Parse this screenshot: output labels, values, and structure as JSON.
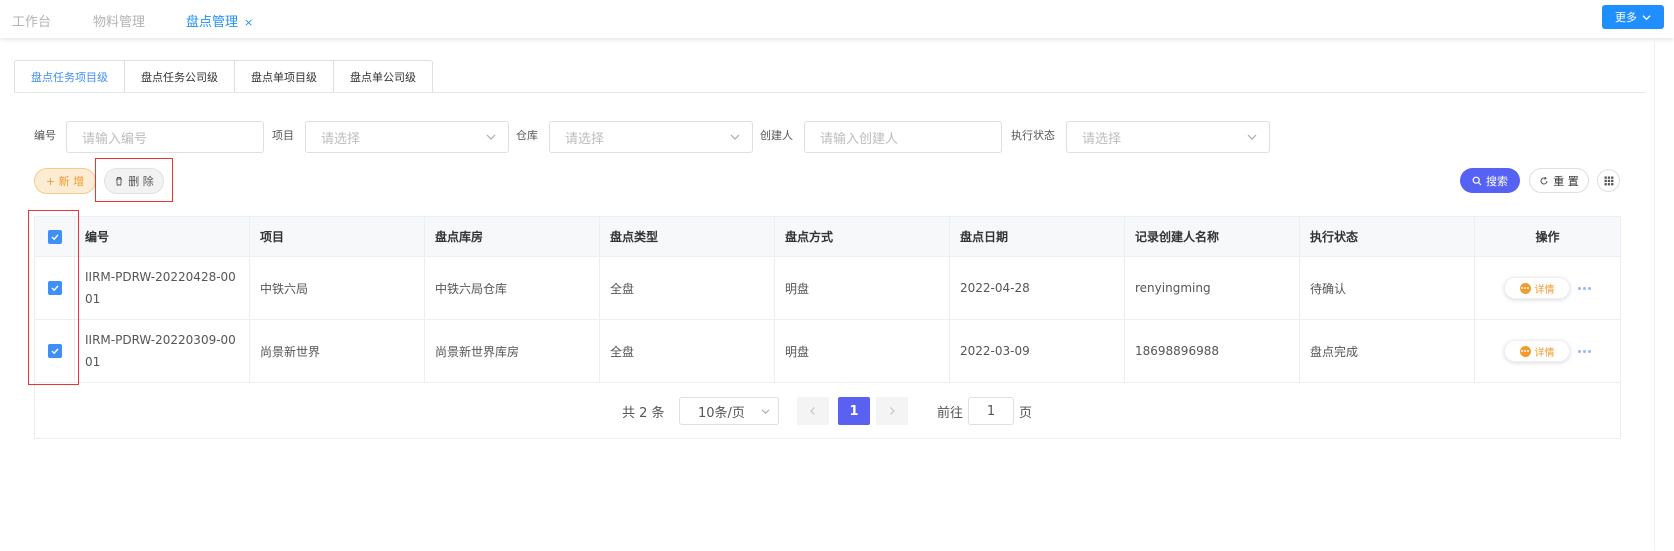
{
  "top_tabs": [
    {
      "label": "工作台"
    },
    {
      "label": "物料管理"
    },
    {
      "label": "盘点管理",
      "close": "×"
    }
  ],
  "more_button": "更多",
  "sub_tabs": [
    "盘点任务项目级",
    "盘点任务公司级",
    "盘点单项目级",
    "盘点单公司级"
  ],
  "filters": {
    "code": {
      "label": "编号",
      "placeholder": "请输入编号"
    },
    "project": {
      "label": "项目",
      "placeholder": "请选择"
    },
    "warehouse": {
      "label": "仓库",
      "placeholder": "请选择"
    },
    "creator": {
      "label": "创建人",
      "placeholder": "请输入创建人"
    },
    "status": {
      "label": "执行状态",
      "placeholder": "请选择"
    }
  },
  "actions": {
    "add": "+ 新 增",
    "delete": "删 除",
    "search": "搜索",
    "reset": "重 置"
  },
  "table": {
    "headers": [
      "编号",
      "项目",
      "盘点库房",
      "盘点类型",
      "盘点方式",
      "盘点日期",
      "记录创建人名称",
      "执行状态",
      "操作"
    ],
    "rows": [
      {
        "code": "IIRM-PDRW-20220428-0001",
        "project": "中铁六局",
        "warehouse": "中铁六局仓库",
        "type": "全盘",
        "method": "明盘",
        "date": "2022-04-28",
        "creator": "renyingming",
        "status": "待确认",
        "checked": true
      },
      {
        "code": "IIRM-PDRW-20220309-0001",
        "project": "尚景新世界",
        "warehouse": "尚景新世界库房",
        "type": "全盘",
        "method": "明盘",
        "date": "2022-03-09",
        "creator": "18698896988",
        "status": "盘点完成",
        "checked": true
      }
    ],
    "detail_label": "详情"
  },
  "pagination": {
    "total": "共 2 条",
    "page_size": "10条/页",
    "current_page": "1",
    "goto_label": "前往",
    "goto_value": "1",
    "page_suffix": "页"
  },
  "colors": {
    "primary": "#1f8fff",
    "accent": "#5662f6",
    "orange": "#f39b2a",
    "highlight": "#e33333"
  }
}
